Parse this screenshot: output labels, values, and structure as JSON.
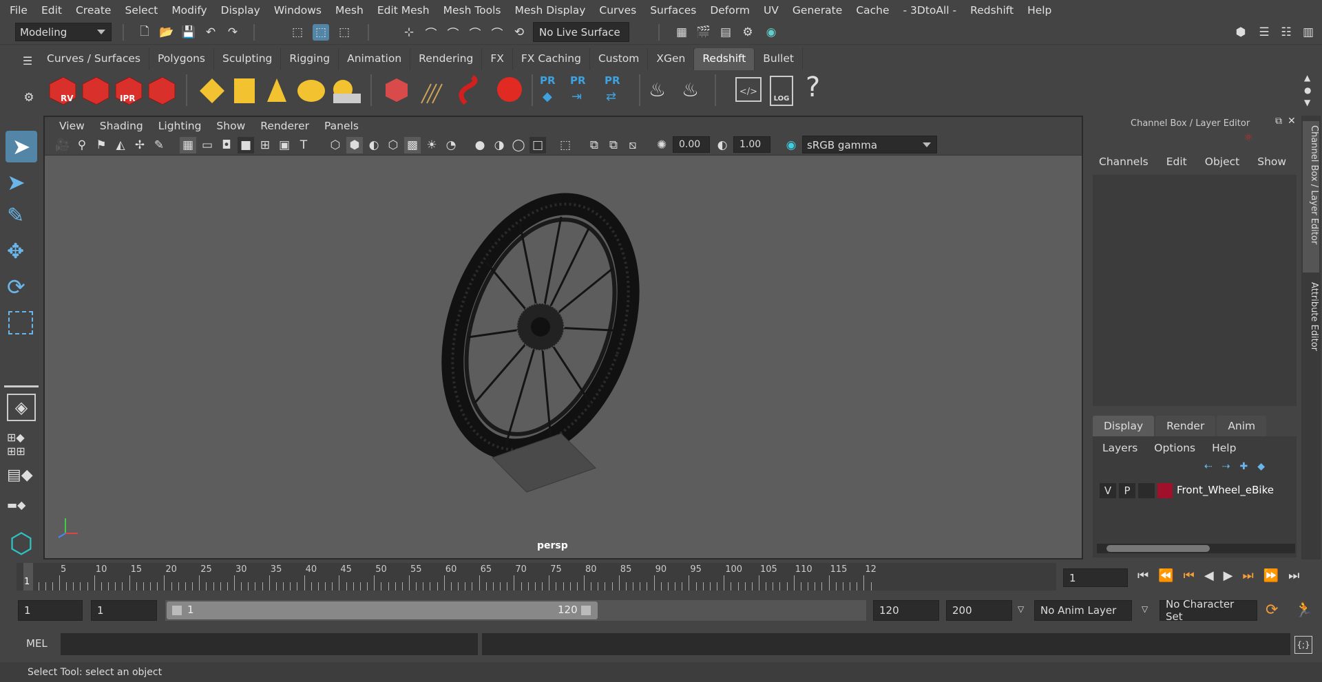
{
  "menubar": [
    "File",
    "Edit",
    "Create",
    "Select",
    "Modify",
    "Display",
    "Windows",
    "Mesh",
    "Edit Mesh",
    "Mesh Tools",
    "Mesh Display",
    "Curves",
    "Surfaces",
    "Deform",
    "UV",
    "Generate",
    "Cache",
    "- 3DtoAll -",
    "Redshift",
    "Help"
  ],
  "status": {
    "workspace": "Modeling",
    "live_surface": "No Live Surface"
  },
  "shelf_tabs": [
    "Curves / Surfaces",
    "Polygons",
    "Sculpting",
    "Rigging",
    "Animation",
    "Rendering",
    "FX",
    "FX Caching",
    "Custom",
    "XGen",
    "Redshift",
    "Bullet"
  ],
  "active_shelf_tab": "Redshift",
  "shelf_labels": {
    "rv": "RV",
    "ipr": "IPR",
    "pr1": "PR",
    "pr2": "PR",
    "pr3": "PR",
    "log": "LOG",
    "help": "?"
  },
  "viewport": {
    "menu": [
      "View",
      "Shading",
      "Lighting",
      "Show",
      "Renderer",
      "Panels"
    ],
    "exposure": "0.00",
    "gamma": "1.00",
    "colorspace": "sRGB gamma",
    "camera_label": "persp"
  },
  "channel_box": {
    "title": "Channel Box / Layer Editor",
    "menu": [
      "Channels",
      "Edit",
      "Object",
      "Show"
    ],
    "side_tabs": [
      "Channel Box / Layer Editor",
      "Attribute Editor"
    ]
  },
  "layer_editor": {
    "tabs": [
      "Display",
      "Render",
      "Anim"
    ],
    "active_tab": "Display",
    "menu": [
      "Layers",
      "Options",
      "Help"
    ],
    "layer": {
      "v": "V",
      "p": "P",
      "name": "Front_Wheel_eBike",
      "color": "#a0102a"
    }
  },
  "timeline": {
    "ticks": [
      "5",
      "10",
      "15",
      "20",
      "25",
      "30",
      "35",
      "40",
      "45",
      "50",
      "55",
      "60",
      "65",
      "70",
      "75",
      "80",
      "85",
      "90",
      "95",
      "100",
      "105",
      "110",
      "115",
      "12"
    ],
    "current_marker": "1",
    "current_frame": "1"
  },
  "range": {
    "start": "1",
    "inner_start": "1",
    "slider_start": "1",
    "slider_end": "120",
    "end": "120",
    "outer_end": "200",
    "anim_layer": "No Anim Layer",
    "char_set": "No Character Set"
  },
  "mel": {
    "label": "MEL"
  },
  "statusbar": {
    "text": "Select Tool: select an object"
  }
}
